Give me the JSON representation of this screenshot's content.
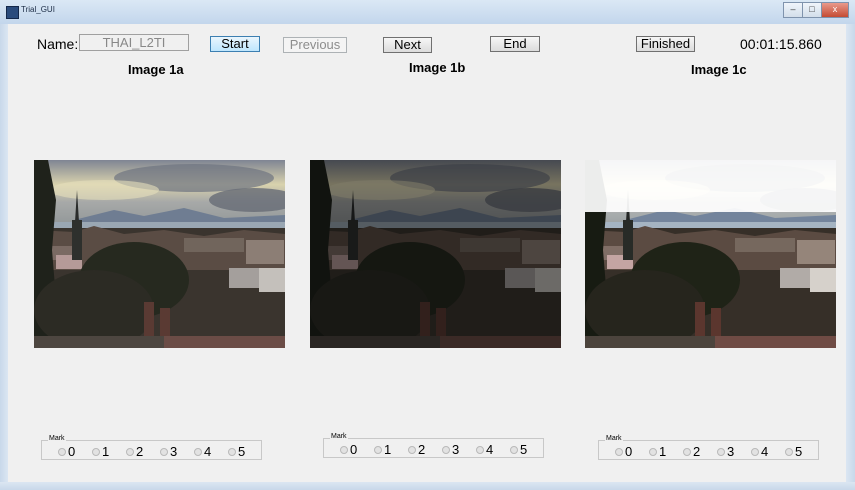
{
  "window": {
    "title": "Trial_GUI",
    "minimize": "–",
    "maximize": "□",
    "close": "x"
  },
  "header": {
    "name_label": "Name:",
    "name_value": "THAI_L2TI",
    "start_label": "Start",
    "previous_label": "Previous",
    "next_label": "Next",
    "end_label": "End",
    "finished_label": "Finished",
    "timer": "00:01:15.860"
  },
  "panels": [
    {
      "title": "Image 1a",
      "mark_legend": "Mark",
      "options": [
        "0",
        "1",
        "2",
        "3",
        "4",
        "5"
      ],
      "brightness": "normal"
    },
    {
      "title": "Image 1b",
      "mark_legend": "Mark",
      "options": [
        "0",
        "1",
        "2",
        "3",
        "4",
        "5"
      ],
      "brightness": "dark"
    },
    {
      "title": "Image 1c",
      "mark_legend": "Mark",
      "options": [
        "0",
        "1",
        "2",
        "3",
        "4",
        "5"
      ],
      "brightness": "bright"
    }
  ],
  "colors": {
    "active_button": "#bee6fd",
    "window_background": "#f0f0f0"
  }
}
